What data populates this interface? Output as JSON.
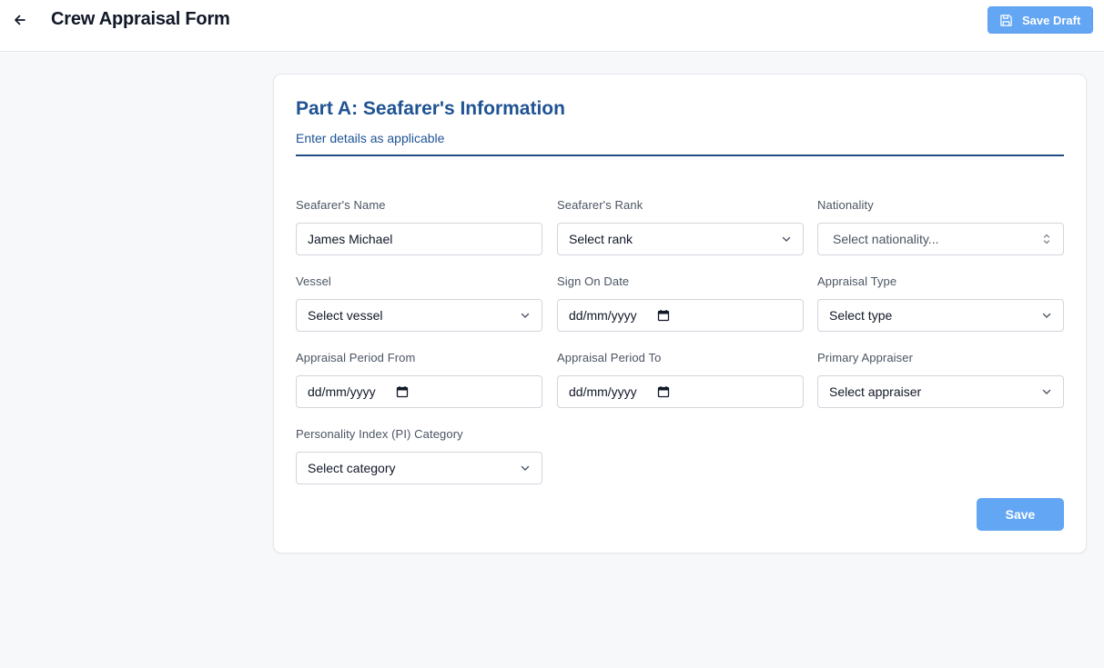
{
  "header": {
    "title": "Crew Appraisal Form",
    "save_draft_label": "Save Draft",
    "accent": "#63a6f4"
  },
  "section": {
    "title": "Part A: Seafarer's Information",
    "subtitle": "Enter details as applicable",
    "title_color": "#1f5394"
  },
  "fields": {
    "name": {
      "label": "Seafarer's Name",
      "value": "James Michael"
    },
    "rank": {
      "label": "Seafarer's Rank",
      "value": "Select rank"
    },
    "nationality": {
      "label": "Nationality",
      "value": "Select nationality..."
    },
    "vessel": {
      "label": "Vessel",
      "value": "Select vessel"
    },
    "sign_on": {
      "label": "Sign On Date",
      "value": "dd/mm/yyyy"
    },
    "appraisal_type": {
      "label": "Appraisal Type",
      "value": "Select type"
    },
    "period_from": {
      "label": "Appraisal Period From",
      "value": "dd/mm/yyyy"
    },
    "period_to": {
      "label": "Appraisal Period To",
      "value": "dd/mm/yyyy"
    },
    "primary_appraiser": {
      "label": "Primary Appraiser",
      "value": "Select appraiser"
    },
    "pi_category": {
      "label": "Personality Index (PI) Category",
      "value": "Select category"
    }
  },
  "actions": {
    "save_label": "Save"
  },
  "icons": {
    "back": "arrow-left-icon",
    "save": "floppy-disk-icon",
    "dropdown": "chevron-down-icon",
    "combobox": "chevrons-up-down-icon",
    "calendar": "calendar-icon"
  }
}
